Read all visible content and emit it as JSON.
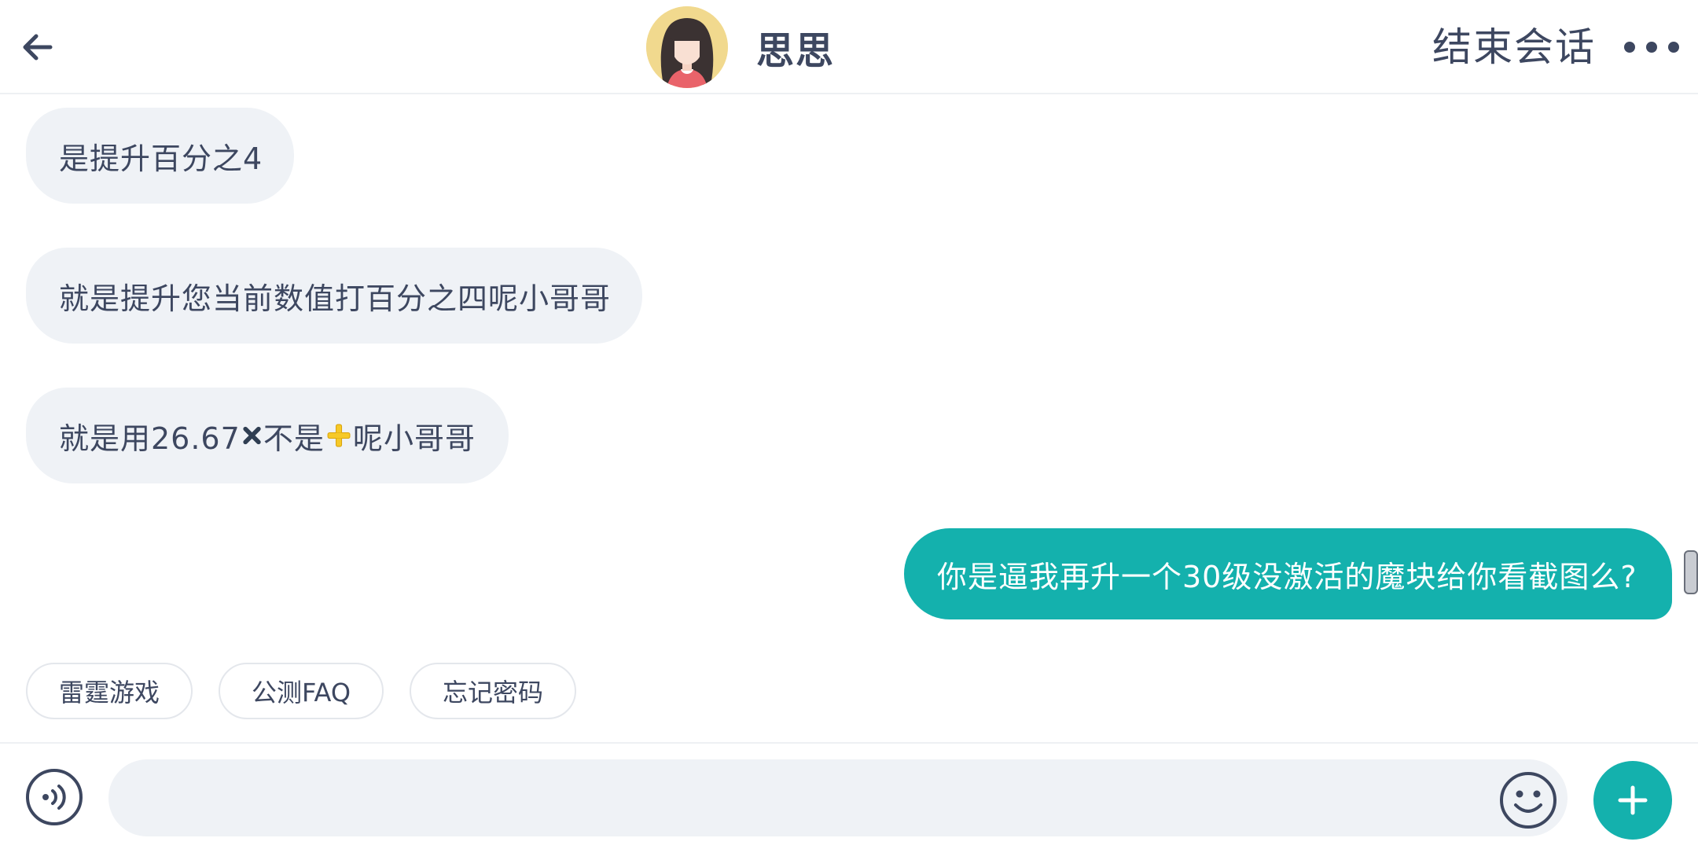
{
  "header": {
    "agent_name": "思思",
    "end_session_label": "结束会话",
    "icons": {
      "back": "arrow-left-icon",
      "more": "more-horizontal-icon",
      "avatar": "agent-avatar"
    }
  },
  "messages": [
    {
      "sender": "agent",
      "text": "是提升百分之4"
    },
    {
      "sender": "agent",
      "text": "就是提升您当前数值打百分之四呢小哥哥"
    },
    {
      "sender": "agent",
      "parts": {
        "before": "就是用26.67",
        "middle": "不是",
        "after": "呢小哥哥"
      },
      "emojis": [
        "heavy-multiplication-x-emoji",
        "heavy-plus-sign-emoji"
      ]
    },
    {
      "sender": "user",
      "text": "你是逼我再升一个30级没激活的魔块给你看截图么?"
    }
  ],
  "quick_replies": [
    {
      "label": "雷霆游戏"
    },
    {
      "label": "公测FAQ"
    },
    {
      "label": "忘记密码"
    }
  ],
  "input_bar": {
    "value": "",
    "icons": {
      "voice": "voice-input-icon",
      "emoji": "smiley-face-icon",
      "plus": "plus-icon"
    }
  },
  "colors": {
    "accent": "#14b1ad",
    "text_primary": "#3d4760",
    "bubble_incoming": "#eff2f6",
    "bubble_outgoing": "#14b1ad",
    "input_background": "#eff2f6"
  }
}
